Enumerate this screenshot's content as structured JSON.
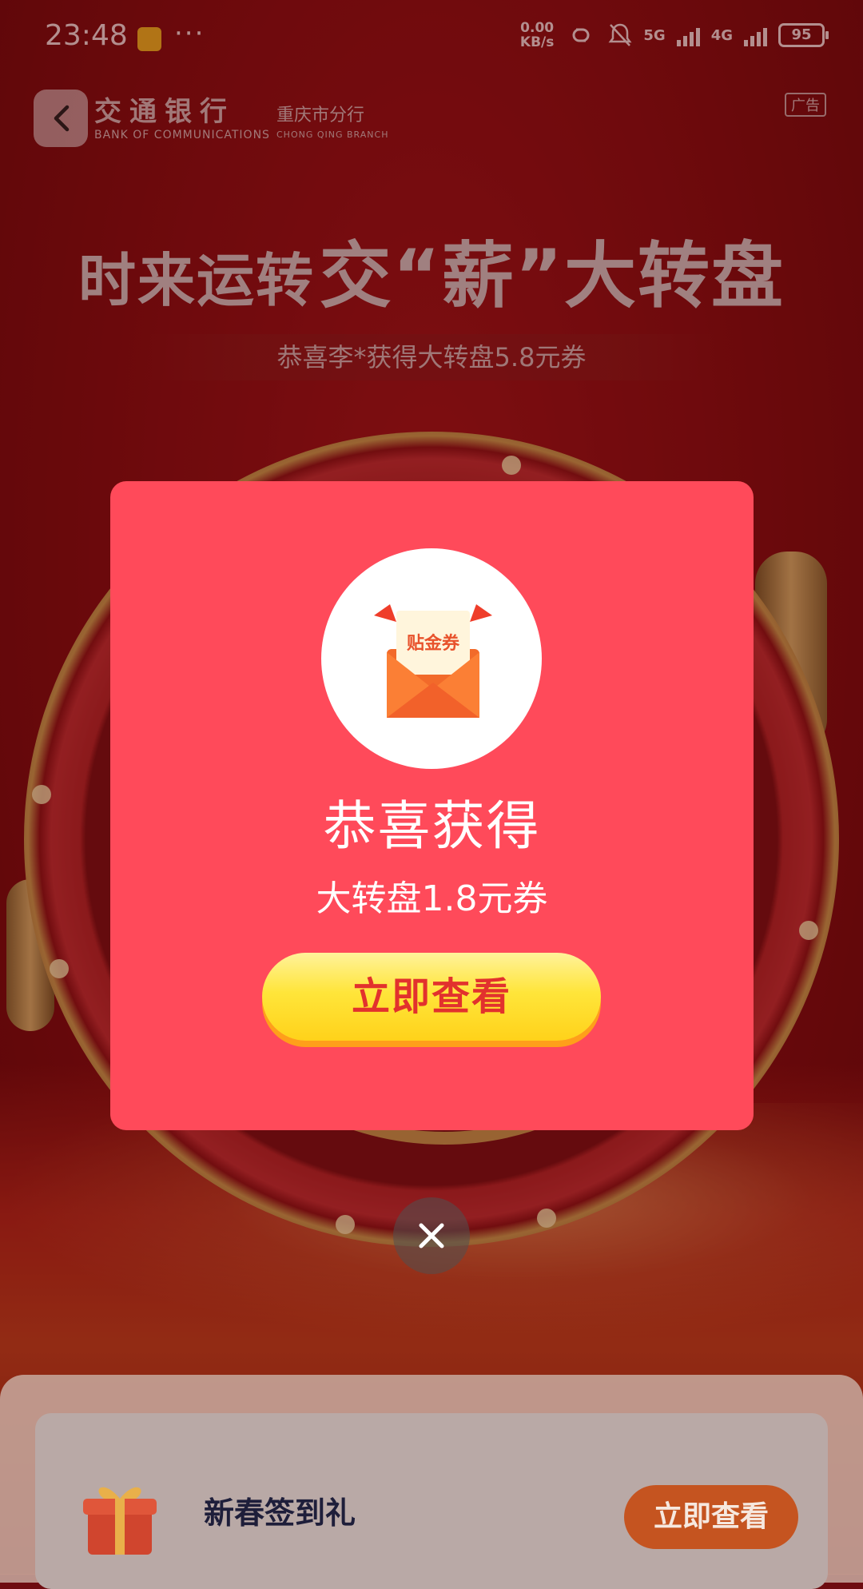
{
  "status_bar": {
    "time": "23:48",
    "more": "···",
    "net_speed": "0.00",
    "net_unit": "KB/s",
    "signal_1": "5G",
    "signal_2": "4G",
    "battery": "95"
  },
  "header": {
    "bank_name_cn": "交通银行",
    "bank_name_en": "BANK OF COMMUNICATIONS",
    "branch_cn": "重庆市分行",
    "branch_en": "CHONG QING BRANCH",
    "ad_label": "广告"
  },
  "hero": {
    "title_part1": "时来运转",
    "title_part2": "交“薪”大转盘",
    "ticker": "恭喜李*获得大转盘5.8元券"
  },
  "modal": {
    "coupon_label": "贴金券",
    "title": "恭喜获得",
    "subtitle": "大转盘1.8元券",
    "button": "立即查看"
  },
  "bottom_card": {
    "title": "新春签到礼",
    "button": "立即查看"
  },
  "colors": {
    "modal_bg": "#ff4a5a",
    "button_yellow": "#ffe53a",
    "button_text": "#e2312d"
  },
  "icons": [
    "back-icon",
    "close-icon",
    "envelope-icon",
    "gift-icon",
    "app-notification-icon",
    "link-icon",
    "mute-icon"
  ]
}
